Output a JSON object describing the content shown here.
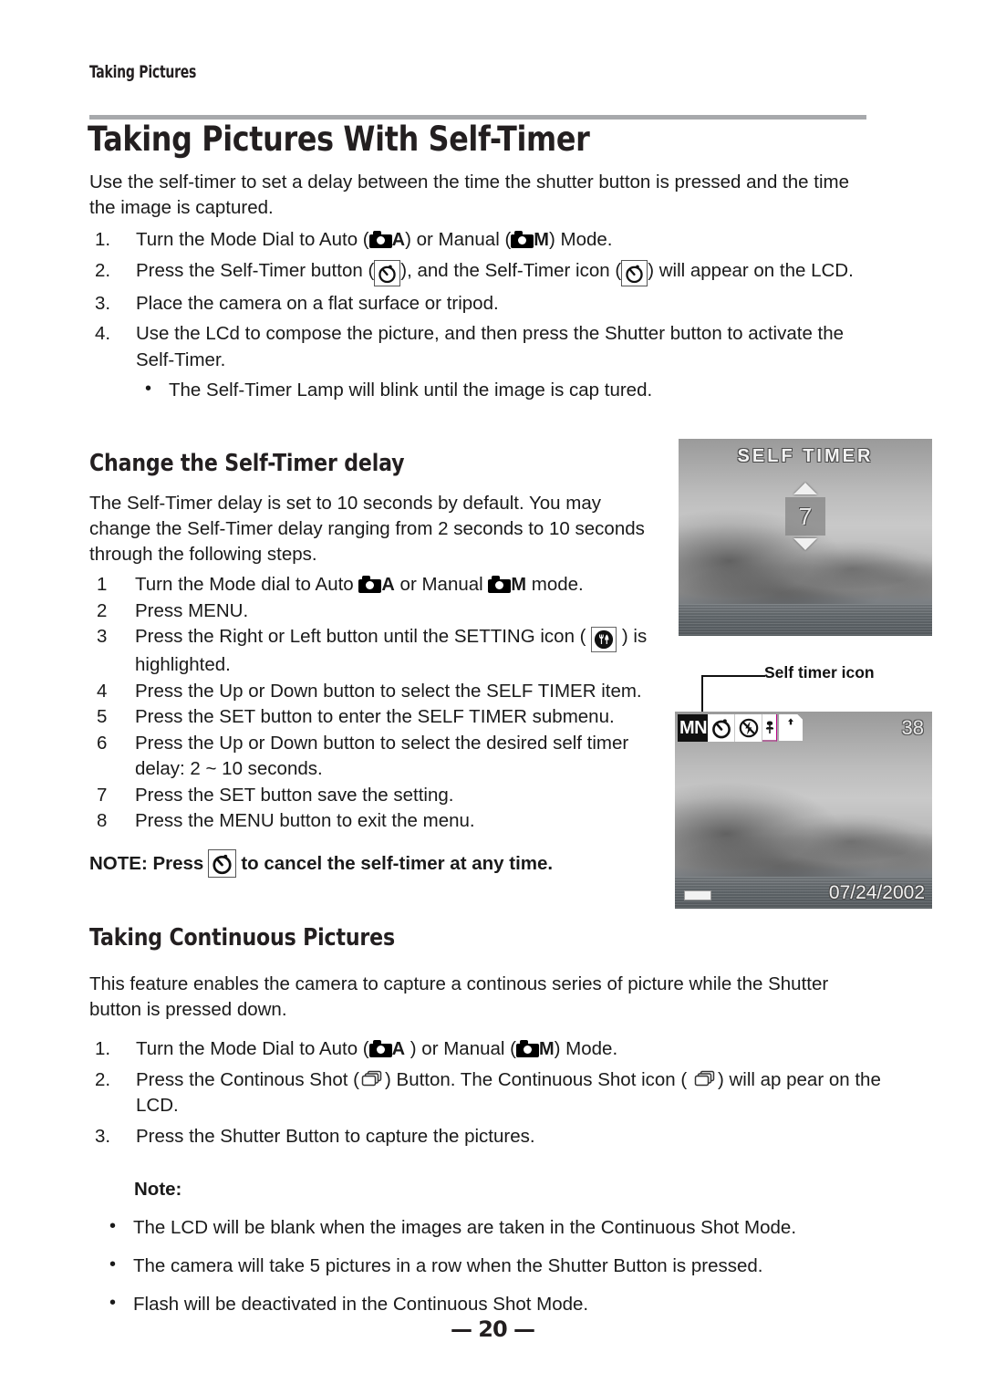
{
  "running_head": "Taking Pictures",
  "title": "Taking Pictures With Self-Timer",
  "intro": "Use the self-timer to set a delay between the time the shutter button is pressed and the time the image is captured.",
  "steps_main": [
    {
      "num": "1.",
      "parts": [
        "Turn the Mode Dial to Auto (",
        "CAM_A",
        ") or Manual (",
        "CAM_M",
        ") Mode."
      ]
    },
    {
      "num": "2.",
      "parts": [
        "Press the Self-Timer button (",
        "TIMER_BOX",
        "), and the Self-Timer icon (",
        "TIMER_BOX",
        ") will appear on the LCD."
      ]
    },
    {
      "num": "3.",
      "parts": [
        "Place the camera on a flat surface or tripod."
      ]
    },
    {
      "num": "4.",
      "parts": [
        "Use the LCd to compose the picture, and then press the Shutter button to activate the Self-Timer."
      ]
    }
  ],
  "step4_bullet": "The Self-Timer Lamp will blink until the image is cap tured.",
  "section_delay": {
    "heading": "Change the Self-Timer delay",
    "para": "The Self-Timer delay is set to 10 seconds by default. You may change the Self-Timer delay ranging from 2 seconds to 10 seconds through the following steps.",
    "steps": [
      {
        "num": "1",
        "text_before": "Turn the Mode dial to Auto ",
        "icon1": "camera-auto-icon",
        "text_mid": " or Manual ",
        "icon2": "camera-manual-icon",
        "text_after": " mode."
      },
      {
        "num": "2",
        "text_before": "Press MENU.",
        "icon1": "",
        "text_mid": "",
        "icon2": "",
        "text_after": ""
      },
      {
        "num": "3",
        "text_before": "Press the Right or Left button until the SETTING icon ( ",
        "icon1": "setting-icon",
        "text_mid": " ) is highlighted.",
        "icon2": "",
        "text_after": ""
      },
      {
        "num": "4",
        "text_before": "Press the Up or Down button to select the SELF TIMER item.",
        "icon1": "",
        "text_mid": "",
        "icon2": "",
        "text_after": ""
      },
      {
        "num": "5",
        "text_before": "Press the SET button to enter the SELF TIMER submenu.",
        "icon1": "",
        "text_mid": "",
        "icon2": "",
        "text_after": ""
      },
      {
        "num": "6",
        "text_before": "Press the Up or Down button to select the desired self timer delay: 2 ~ 10 seconds.",
        "icon1": "",
        "text_mid": "",
        "icon2": "",
        "text_after": ""
      },
      {
        "num": "7",
        "text_before": "Press the SET button save the setting.",
        "icon1": "",
        "text_mid": "",
        "icon2": "",
        "text_after": ""
      },
      {
        "num": "8",
        "text_before": "Press the MENU button to exit the menu.",
        "icon1": "",
        "text_mid": "",
        "icon2": "",
        "text_after": ""
      }
    ],
    "note_before": "NOTE: Press",
    "note_after": "to cancel the self-timer at any time."
  },
  "lcd_timer": {
    "title": "SELF TIMER",
    "value": "7",
    "up_icon": "triangle-up-icon",
    "down_icon": "triangle-down-icon"
  },
  "lcd_preview": {
    "callout": "Self timer icon",
    "mode": "MN",
    "counter": "38",
    "date": "07/24/2002",
    "icons": [
      "self-timer-icon",
      "flash-off-icon",
      "macro-icon",
      "file-icon"
    ]
  },
  "section_continuous": {
    "heading": "Taking Continuous Pictures",
    "para": "This feature enables the camera to capture a continous series of picture while the Shutter button is pressed down.",
    "steps": [
      {
        "num": "1.",
        "text_before": "Turn the Mode Dial to Auto (",
        "text_mid": " ) or Manual (",
        "text_after": ") Mode."
      },
      {
        "num": "2.",
        "text_before": "Press the Continous Shot (",
        "text_mid": ") Button. The Continuous Shot icon ( ",
        "text_after": ") will ap pear on the LCD."
      },
      {
        "num": "3.",
        "text_before": "Press the Shutter Button to capture the pictures.",
        "text_mid": "",
        "text_after": ""
      }
    ],
    "note_label": "Note:",
    "notes": [
      "The LCD will be blank when the images are taken in the Continuous Shot Mode.",
      "The camera will take 5 pictures in a row when the Shutter Button is pressed.",
      "Flash will be deactivated in the Continuous Shot Mode."
    ]
  },
  "footer": {
    "page_number": "— 20 —"
  },
  "colors": {
    "rule": "#a7a9ac",
    "text": "#1a1a1a",
    "heading": "#231f20"
  }
}
